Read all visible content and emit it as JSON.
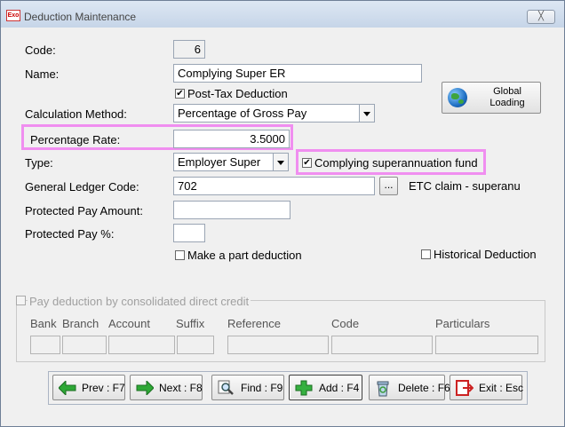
{
  "window": {
    "title": "Deduction Maintenance",
    "app_icon": "Exo",
    "close_label": "╳"
  },
  "form": {
    "code_label": "Code:",
    "code_value": "6",
    "name_label": "Name:",
    "name_value": "Complying Super ER",
    "post_tax_label": "Post-Tax Deduction",
    "post_tax_checked": "✔",
    "calc_method_label": "Calculation Method:",
    "calc_method_value": "Percentage of Gross Pay",
    "percentage_rate_label": "Percentage Rate:",
    "percentage_rate_value": "3.5000",
    "type_label": "Type:",
    "type_value": "Employer Super",
    "complying_label": "Complying superannuation fund",
    "complying_checked": "✔",
    "gl_code_label": "General Ledger Code:",
    "gl_code_value": "702",
    "gl_lookup_label": "...",
    "gl_description": "ETC claim - superanu",
    "protected_amount_label": "Protected Pay Amount:",
    "protected_amount_value": "",
    "protected_pct_label": "Protected Pay %:",
    "protected_pct_value": "",
    "part_deduction_label": "Make a part deduction",
    "historical_label": "Historical Deduction"
  },
  "global_loading": {
    "line1": "Global",
    "line2": "Loading"
  },
  "direct_credit": {
    "title": "Pay deduction by consolidated direct credit",
    "headers": {
      "bank": "Bank",
      "branch": "Branch",
      "account": "Account",
      "suffix": "Suffix",
      "reference": "Reference",
      "code": "Code",
      "particulars": "Particulars"
    }
  },
  "buttons": {
    "prev": "Prev : F7",
    "next": "Next : F8",
    "find": "Find : F9",
    "add": "Add : F4",
    "delete": "Delete : F6",
    "exit": "Exit : Esc"
  },
  "colors": {
    "highlight": "#f08ef0",
    "title_bar": "#c6d5e8"
  }
}
